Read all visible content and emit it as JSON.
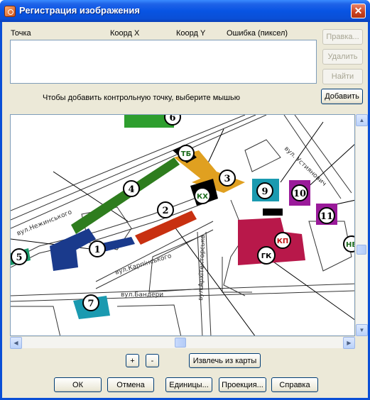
{
  "window": {
    "title": "Регистрация изображения",
    "close_glyph": "✕"
  },
  "columns": [
    "Точка",
    "Коорд X",
    "Коорд Y",
    "Ошибка (пиксел)"
  ],
  "side_buttons": {
    "edit": "Правка...",
    "delete": "Удалить",
    "find": "Найти",
    "add": "Добавить"
  },
  "hint": "Чтобы добавить контрольную точку, выберите мышью",
  "map": {
    "streets": [
      "вул.Нежинського",
      "вул.Карпінського",
      "вул.Архітекторська",
      "вул.Бандери",
      "вул. Устиянович"
    ],
    "markers": [
      "1",
      "2",
      "3",
      "4",
      "5",
      "6",
      "7",
      "9",
      "10",
      "11",
      "ТБ",
      "КХ",
      "КП",
      "ГК",
      "НВ"
    ]
  },
  "zoom": {
    "plus": "+",
    "minus": "-",
    "extract": "Извлечь из карты"
  },
  "bottom_buttons": {
    "ok": "ОК",
    "cancel": "Отмена",
    "units": "Единицы...",
    "projection": "Проекция...",
    "help": "Справка"
  },
  "scroll_arrows": {
    "up": "▲",
    "down": "▼",
    "left": "◀",
    "right": "▶"
  },
  "colors": {
    "green": "#2e7d1e",
    "navy": "#1a3a8c",
    "orange": "#e0a020",
    "red": "#c83010",
    "crimson": "#b8184a",
    "purple": "#9a1a9a",
    "teal": "#1a9ab0"
  }
}
